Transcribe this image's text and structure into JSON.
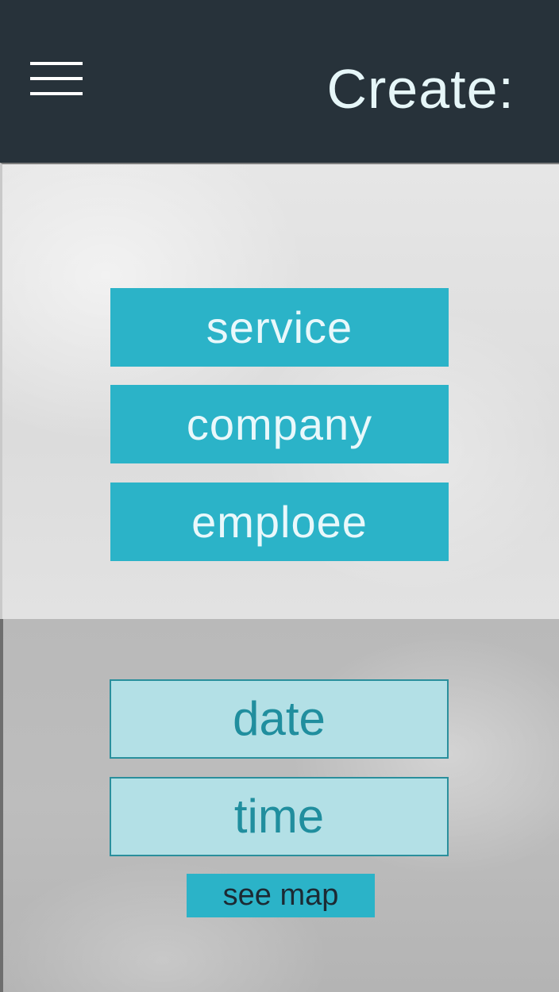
{
  "header": {
    "title": "Create:",
    "menu_icon": "hamburger-menu-icon"
  },
  "options": [
    {
      "label": "service"
    },
    {
      "label": "company"
    },
    {
      "label": "emploee"
    }
  ],
  "fields": {
    "date": {
      "label": "date"
    },
    "time": {
      "label": "time"
    }
  },
  "actions": {
    "see_map_label": "see map"
  },
  "colors": {
    "header_bg": "#27323a",
    "accent": "#2bb3c8",
    "field_bg": "#b3e0e6",
    "field_border": "#2a8f9c",
    "title_text": "#e6f6f8"
  }
}
